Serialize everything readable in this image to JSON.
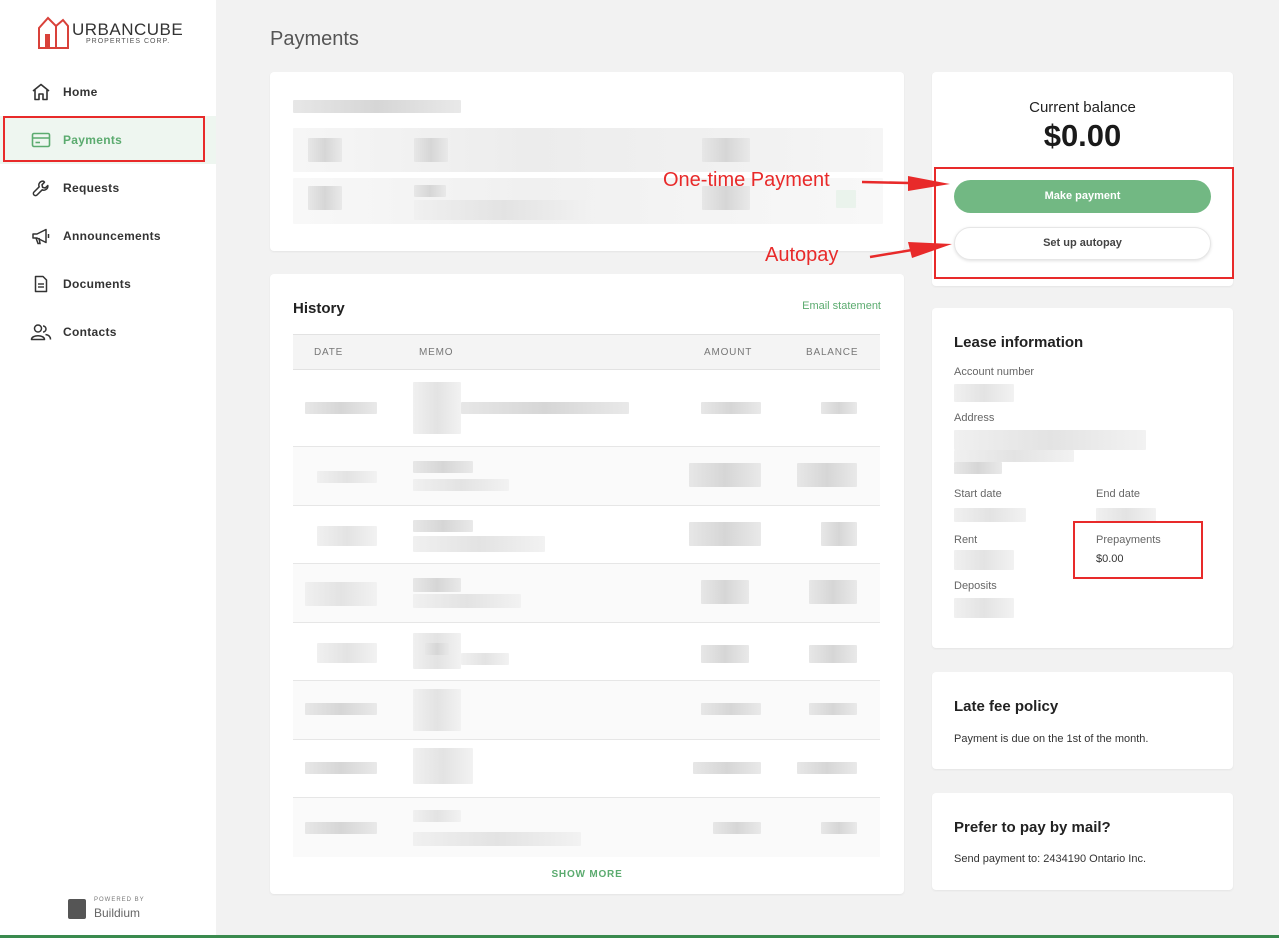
{
  "brand": {
    "name": "URBANCUBE",
    "tagline": "PROPERTIES CORP."
  },
  "nav": [
    {
      "label": "Home",
      "icon": "home-icon"
    },
    {
      "label": "Payments",
      "icon": "credit-card-icon",
      "active": true
    },
    {
      "label": "Requests",
      "icon": "wrench-icon"
    },
    {
      "label": "Announcements",
      "icon": "megaphone-icon"
    },
    {
      "label": "Documents",
      "icon": "document-icon"
    },
    {
      "label": "Contacts",
      "icon": "contacts-icon"
    }
  ],
  "powered": {
    "small": "POWERED BY",
    "brand": "Buildium"
  },
  "page": {
    "title": "Payments"
  },
  "history": {
    "title": "History",
    "email_statement": "Email statement",
    "columns": [
      "DATE",
      "MEMO",
      "AMOUNT",
      "BALANCE"
    ],
    "show_more": "SHOW MORE"
  },
  "balance": {
    "label": "Current balance",
    "value": "$0.00",
    "make_payment": "Make payment",
    "setup_autopay": "Set up autopay"
  },
  "lease": {
    "title": "Lease information",
    "account_number_label": "Account number",
    "address_label": "Address",
    "start_date_label": "Start date",
    "end_date_label": "End date",
    "rent_label": "Rent",
    "prepayments_label": "Prepayments",
    "prepayments_value": "$0.00",
    "deposits_label": "Deposits"
  },
  "late_fee": {
    "title": "Late fee policy",
    "text": "Payment is due on the 1st of the month."
  },
  "mail": {
    "title": "Prefer to pay by mail?",
    "text": "Send payment to: 2434190 Ontario Inc."
  },
  "annotations": {
    "one_time": "One-time Payment",
    "autopay": "Autopay"
  },
  "colors": {
    "accent": "#5bab6f",
    "button": "#72b883",
    "annotation": "#e82a2a"
  }
}
